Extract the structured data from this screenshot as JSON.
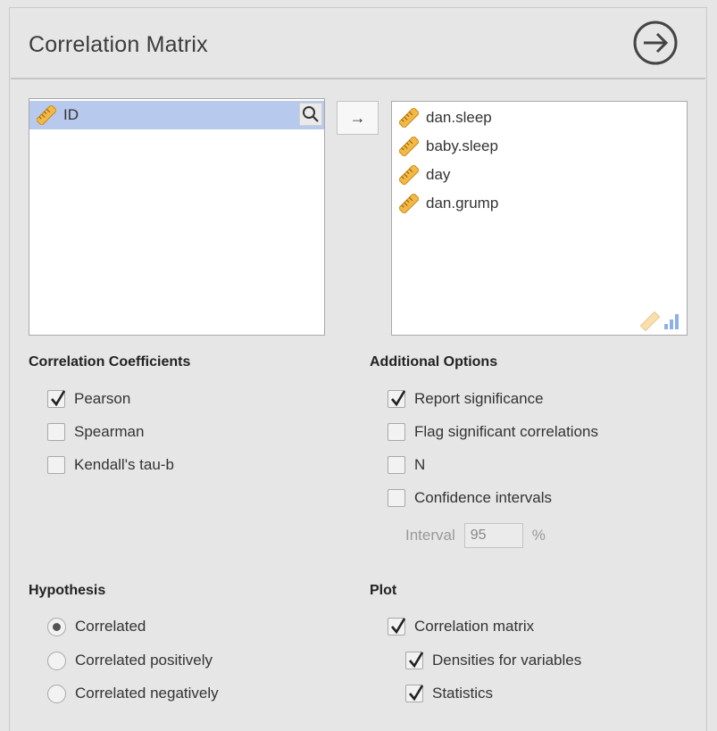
{
  "panel": {
    "title": "Correlation Matrix"
  },
  "source_list": {
    "items": [
      {
        "label": "ID",
        "selected": true
      }
    ]
  },
  "move_button": {
    "label": "→"
  },
  "target_list": {
    "items": [
      {
        "label": "dan.sleep"
      },
      {
        "label": "baby.sleep"
      },
      {
        "label": "day"
      },
      {
        "label": "dan.grump"
      }
    ]
  },
  "correlation_coefficients": {
    "heading": "Correlation Coefficients",
    "options": [
      {
        "label": "Pearson",
        "checked": true
      },
      {
        "label": "Spearman",
        "checked": false
      },
      {
        "label": "Kendall's tau-b",
        "checked": false
      }
    ]
  },
  "additional_options": {
    "heading": "Additional Options",
    "options": [
      {
        "label": "Report significance",
        "checked": true
      },
      {
        "label": "Flag significant correlations",
        "checked": false
      },
      {
        "label": "N",
        "checked": false
      },
      {
        "label": "Confidence intervals",
        "checked": false
      }
    ],
    "interval": {
      "label": "Interval",
      "value": "95",
      "unit": "%"
    }
  },
  "hypothesis": {
    "heading": "Hypothesis",
    "options": [
      {
        "label": "Correlated",
        "selected": true
      },
      {
        "label": "Correlated positively",
        "selected": false
      },
      {
        "label": "Correlated negatively",
        "selected": false
      }
    ]
  },
  "plot": {
    "heading": "Plot",
    "options": [
      {
        "label": "Correlation matrix",
        "checked": true
      },
      {
        "label": "Densities for variables",
        "checked": true
      },
      {
        "label": "Statistics",
        "checked": true
      }
    ]
  },
  "colors": {
    "selection": "#b7c9ec",
    "ruler": "#f0b43c",
    "background": "#e6e6e6"
  },
  "icons": {
    "variable": "ruler-icon",
    "search": "search-icon",
    "run": "arrow-circle-right-icon",
    "types": "continuous-ordinal-icon"
  }
}
